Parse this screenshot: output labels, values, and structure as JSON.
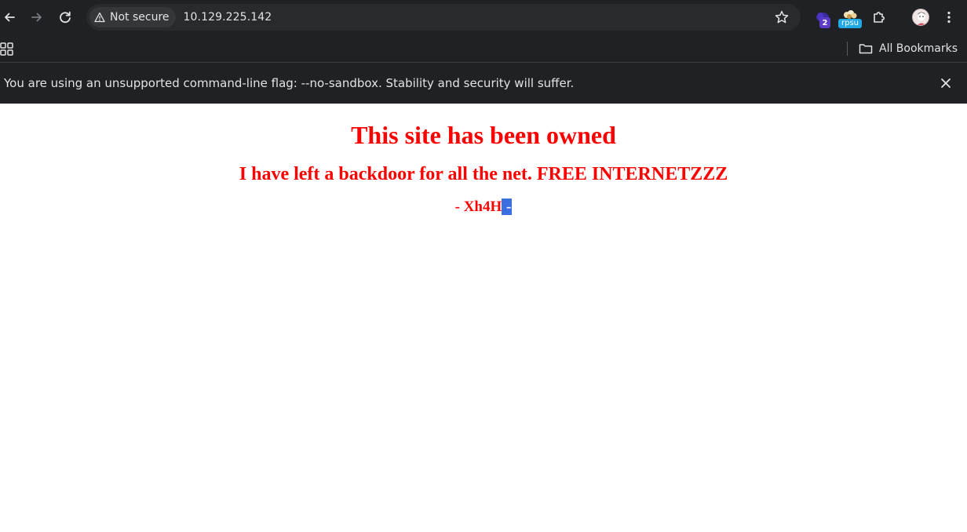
{
  "browser": {
    "security_label": "Not secure",
    "url": "10.129.225.142",
    "extension_badge_count": "2",
    "extension_rpsu_label": "rpsu",
    "bookmarks_label": "All Bookmarks",
    "infobar_message": "You are using an unsupported command-line flag: --no-sandbox. Stability and security will suffer."
  },
  "page": {
    "heading": "This site has been owned",
    "subheading": "I have left a backdoor for all the net. FREE INTERNETZZZ",
    "signature": "- Xh4H",
    "selected_text": " -",
    "text_color": "#ff0000"
  },
  "icons": {
    "back": "arrow-left-icon",
    "forward": "arrow-right-icon",
    "reload": "reload-icon",
    "warning": "warning-triangle-icon",
    "star": "star-icon",
    "extensions": "puzzle-icon",
    "menu": "kebab-menu-icon",
    "apps": "apps-grid-icon",
    "folder": "folder-icon",
    "close": "close-icon"
  }
}
